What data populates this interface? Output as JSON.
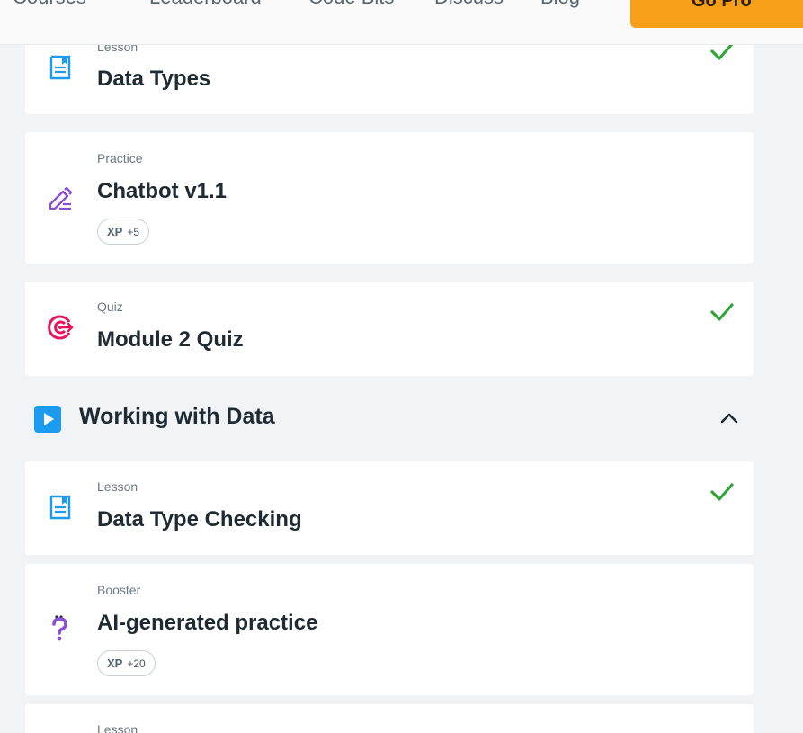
{
  "nav": {
    "items": [
      "Courses",
      "Leaderboard",
      "Code Bits",
      "Discuss",
      "Blog"
    ],
    "cta": "Go Pro"
  },
  "colors": {
    "lesson_icon": "#1d9bf0",
    "practice_icon": "#8a4fd6",
    "quiz_icon": "#e8175d",
    "booster_icon": "#8a4fd6",
    "check": "#2fa637",
    "cta": "#f7a017"
  },
  "cards_before": [
    {
      "type": "Lesson",
      "title": "Data Types",
      "icon": "lesson-document-icon",
      "completed": true
    },
    {
      "type": "Practice",
      "title": "Chatbot v1.1",
      "icon": "pencil-icon",
      "xp_label": "XP",
      "xp_value": "+5",
      "completed": false
    },
    {
      "type": "Quiz",
      "title": "Module 2 Quiz",
      "icon": "target-icon",
      "completed": true
    }
  ],
  "section": {
    "title": "Working with Data",
    "icon": "play-icon",
    "expanded": true
  },
  "cards_after": [
    {
      "type": "Lesson",
      "title": "Data Type Checking",
      "icon": "lesson-document-icon",
      "completed": true
    },
    {
      "type": "Booster",
      "title": "AI-generated practice",
      "icon": "question-mark-icon",
      "xp_label": "XP",
      "xp_value": "+20",
      "completed": false
    },
    {
      "type": "Lesson",
      "title": "",
      "icon": "lesson-document-icon",
      "completed": false
    }
  ]
}
